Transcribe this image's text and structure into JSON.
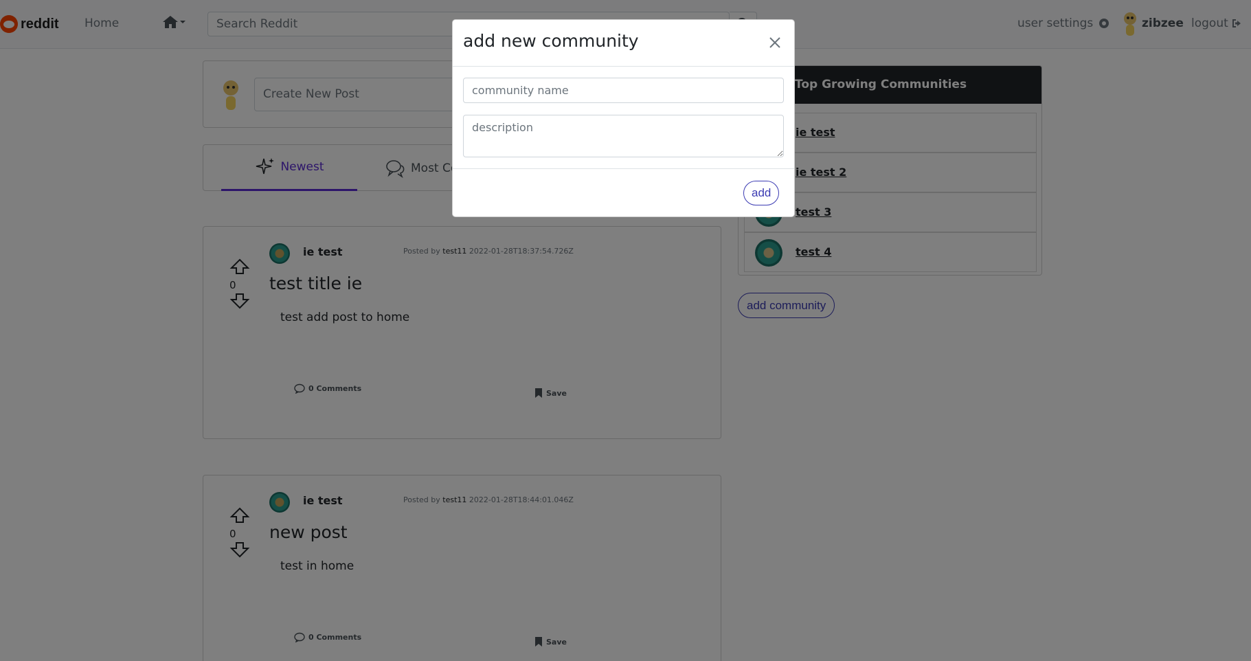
{
  "navbar": {
    "brand": "reddit",
    "home_label": "Home",
    "search_placeholder": "Search Reddit",
    "user_settings_label": "user settings",
    "username": "zibzee",
    "logout_label": "logout"
  },
  "create_post": {
    "placeholder": "Create New Post"
  },
  "tabs": [
    {
      "label": "Newest",
      "active": true
    },
    {
      "label": "Most Co",
      "active": false
    }
  ],
  "posts": [
    {
      "votes": "0",
      "community": "ie test",
      "posted_by_prefix": "Posted by",
      "author": "test11",
      "timestamp": "2022-01-28T18:37:54.726Z",
      "title": "test title ie",
      "body": "test add post to home",
      "comments": "0 Comments",
      "save": "Save"
    },
    {
      "votes": "0",
      "community": "ie test",
      "posted_by_prefix": "Posted by",
      "author": "test11",
      "timestamp": "2022-01-28T18:44:01.046Z",
      "title": "new post",
      "body": "test in home",
      "comments": "0 Comments",
      "save": "Save"
    }
  ],
  "sidebar": {
    "header": "Top Growing Communities",
    "communities": [
      {
        "name": "ie test"
      },
      {
        "name": "ie test 2"
      },
      {
        "name": "test 3"
      },
      {
        "name": "test 4"
      }
    ],
    "add_community_label": "add community"
  },
  "modal": {
    "title": "add new community",
    "name_placeholder": "community name",
    "description_placeholder": "description",
    "add_label": "add"
  },
  "colors": {
    "brand": "#ff4500",
    "accent": "#5b2bd5",
    "button_outline": "#3b3bb3",
    "sidebar_header_bg": "#212529"
  },
  "icons": [
    "reddit-logo-icon",
    "home-icon",
    "chevron-down-icon",
    "search-icon",
    "gear-icon",
    "logout-icon",
    "sparkles-icon",
    "chat-bubbles-icon",
    "arrow-up-icon",
    "arrow-down-icon",
    "comment-icon",
    "bookmark-icon",
    "close-icon"
  ]
}
